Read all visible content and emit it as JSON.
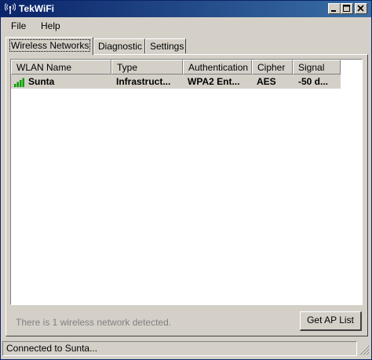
{
  "window": {
    "title": "TekWiFi"
  },
  "menu": {
    "items": [
      "File",
      "Help"
    ]
  },
  "tabs": [
    {
      "label": "Wireless Networks",
      "active": true
    },
    {
      "label": "Diagnostic",
      "active": false
    },
    {
      "label": "Settings",
      "active": false
    }
  ],
  "table": {
    "columns": [
      "WLAN Name",
      "Type",
      "Authentication",
      "Cipher",
      "Signal"
    ],
    "rows": [
      {
        "name": "Sunta",
        "type": "Infrastruct...",
        "auth": "WPA2 Ent...",
        "cipher": "AES",
        "signal": "-50 d..."
      }
    ]
  },
  "status_message": "There is 1 wireless network detected.",
  "buttons": {
    "get_ap_list": "Get AP List"
  },
  "statusbar": {
    "text": "Connected to Sunta..."
  },
  "colors": {
    "titlebar_start": "#0a246a",
    "titlebar_end": "#3a6ea5",
    "face": "#d4d0c8",
    "signal_green": "#00a000"
  },
  "icons": [
    "wifi-antenna-icon",
    "minimize-icon",
    "maximize-icon",
    "close-icon",
    "signal-strength-icon",
    "size-grip-icon"
  ]
}
